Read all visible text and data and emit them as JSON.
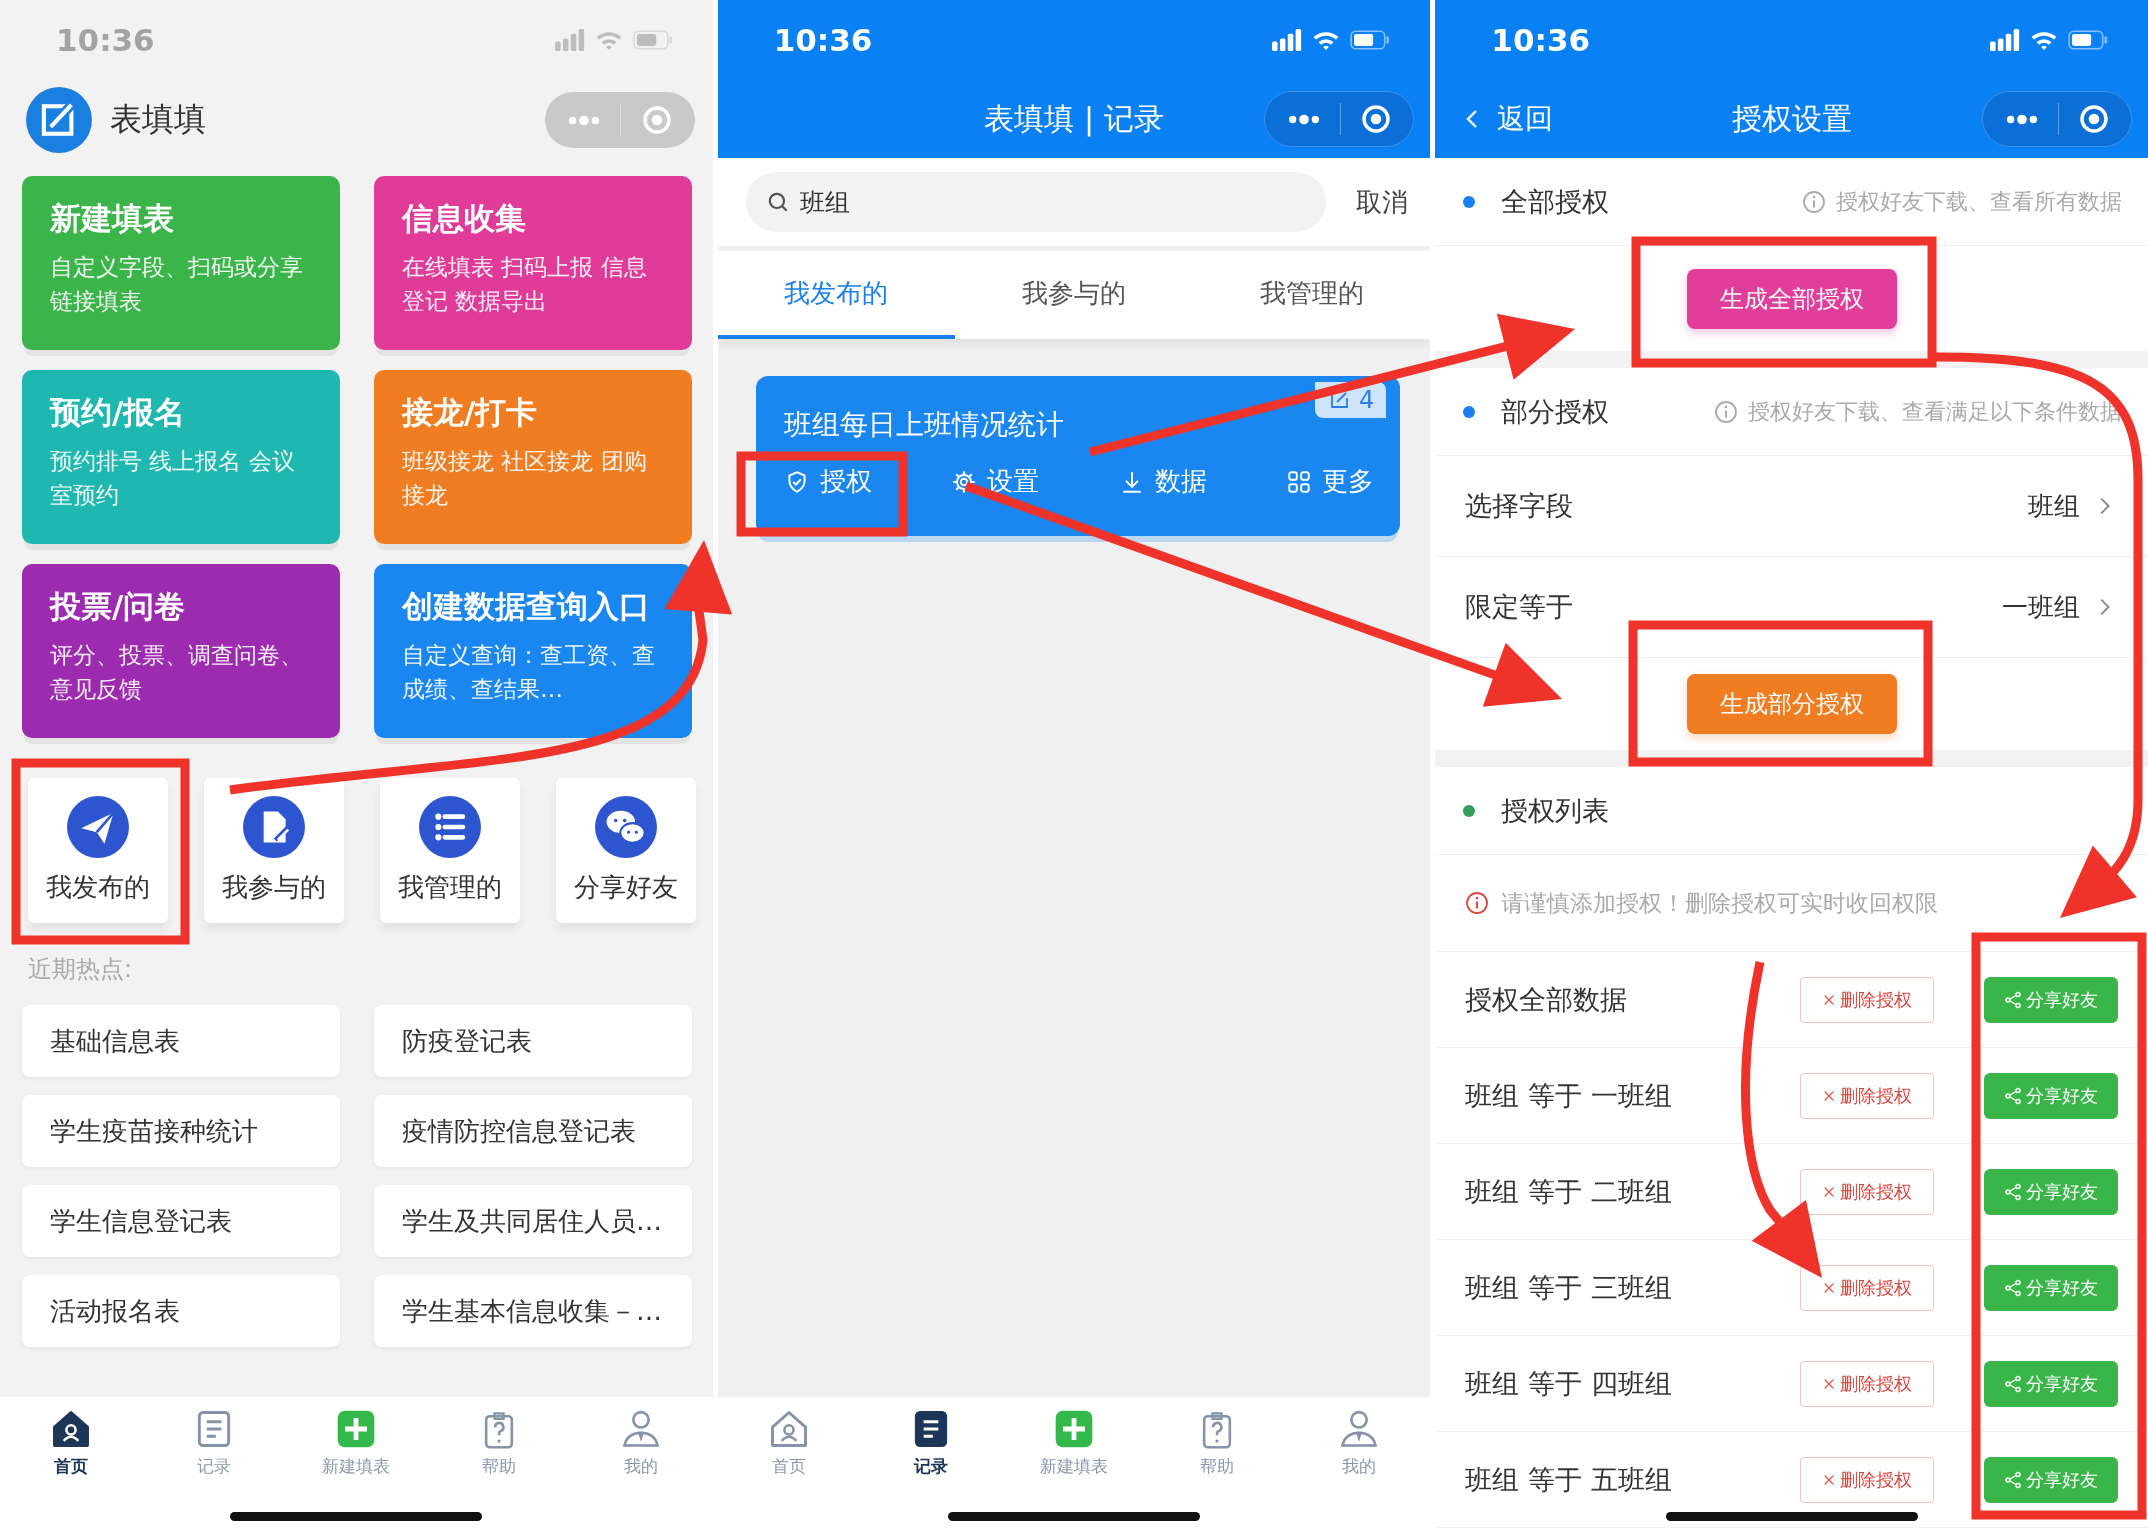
{
  "home_screen": {
    "status_bar": {
      "time": "10:36"
    },
    "header": {
      "title": "表填填"
    },
    "feature_cards": [
      {
        "title": "新建填表",
        "description": "自定义字段、扫码或分享链接填表",
        "color": "#3bb54a"
      },
      {
        "title": "信息收集",
        "description": "在线填表 扫码上报 信息登记 数据导出",
        "color": "#e03b98"
      },
      {
        "title": "预约/报名",
        "description": "预约排号 线上报名 会议室预约",
        "color": "#1fb8b0"
      },
      {
        "title": "接龙/打卡",
        "description": "班级接龙 社区接龙 团购接龙",
        "color": "#f07d22"
      },
      {
        "title": "投票/问卷",
        "description": "评分、投票、调查问卷、意见反馈",
        "color": "#9c2bb0"
      },
      {
        "title": "创建数据查询入口",
        "description": "自定义查询：查工资、查成绩、查结果…",
        "color": "#1a86f0"
      }
    ],
    "quick_links": [
      {
        "label": "我发布的",
        "kind": "send"
      },
      {
        "label": "我参与的",
        "kind": "doc"
      },
      {
        "label": "我管理的",
        "kind": "list"
      },
      {
        "label": "分享好友",
        "kind": "chat"
      }
    ],
    "section_label": "近期热点:",
    "hot_items": [
      "基础信息表",
      "防疫登记表",
      "学生疫苗接种统计",
      "疫情防控信息登记表",
      "学生信息登记表",
      "学生及共同居住人员…",
      "活动报名表",
      "学生基本信息收集－…"
    ],
    "tab_bar": [
      {
        "label": "首页",
        "kind": "home",
        "selected": true
      },
      {
        "label": "记录",
        "kind": "records",
        "selected": false
      },
      {
        "label": "新建填表",
        "kind": "add",
        "selected": false
      },
      {
        "label": "帮助",
        "kind": "help",
        "selected": false
      },
      {
        "label": "我的",
        "kind": "profile",
        "selected": false
      }
    ]
  },
  "records_screen": {
    "status_bar": {
      "time": "10:36"
    },
    "nav": {
      "title": "表填填 | 记录"
    },
    "search": {
      "value": "班组",
      "cancel": "取消"
    },
    "tabs": [
      {
        "label": "我发布的",
        "selected": true
      },
      {
        "label": "我参与的",
        "selected": false
      },
      {
        "label": "我管理的",
        "selected": false
      }
    ],
    "records": [
      {
        "title": "班组每日上班情况统计",
        "count": "4",
        "actions": [
          {
            "label": "授权",
            "kind": "shield"
          },
          {
            "label": "设置",
            "kind": "gear"
          },
          {
            "label": "数据",
            "kind": "download"
          },
          {
            "label": "更多",
            "kind": "grid"
          }
        ]
      }
    ],
    "tab_bar": [
      {
        "label": "首页",
        "kind": "home",
        "selected": false
      },
      {
        "label": "记录",
        "kind": "records",
        "selected": true
      },
      {
        "label": "新建填表",
        "kind": "add",
        "selected": false
      },
      {
        "label": "帮助",
        "kind": "help",
        "selected": false
      },
      {
        "label": "我的",
        "kind": "profile",
        "selected": false
      }
    ]
  },
  "auth_screen": {
    "status_bar": {
      "time": "10:36"
    },
    "nav": {
      "back": "返回",
      "title": "授权设置"
    },
    "sections": [
      {
        "kind": "full",
        "label": "全部授权",
        "color": "#1a7ff0",
        "hint": "授权好友下载、查看所有数据",
        "button": "生成全部授权"
      },
      {
        "kind": "partial",
        "label": "部分授权",
        "color": "#1a7ff0",
        "hint": "授权好友下载、查看满足以下条件数据",
        "fields": [
          {
            "label": "选择字段",
            "value": "班组"
          },
          {
            "label": "限定等于",
            "value": "一班组"
          }
        ],
        "button": "生成部分授权"
      },
      {
        "kind": "list",
        "label": "授权列表",
        "color": "#2ea05a",
        "warning": "请谨慎添加授权！删除授权可实时收回权限",
        "rows": [
          {
            "label": "授权全部数据",
            "delete": "删除授权",
            "share": "分享好友"
          },
          {
            "label": "班组 等于 一班组",
            "delete": "删除授权",
            "share": "分享好友"
          },
          {
            "label": "班组 等于 二班组",
            "delete": "删除授权",
            "share": "分享好友"
          },
          {
            "label": "班组 等于 三班组",
            "delete": "删除授权",
            "share": "分享好友"
          },
          {
            "label": "班组 等于 四班组",
            "delete": "删除授权",
            "share": "分享好友"
          },
          {
            "label": "班组 等于 五班组",
            "delete": "删除授权",
            "share": "分享好友"
          }
        ]
      }
    ]
  }
}
